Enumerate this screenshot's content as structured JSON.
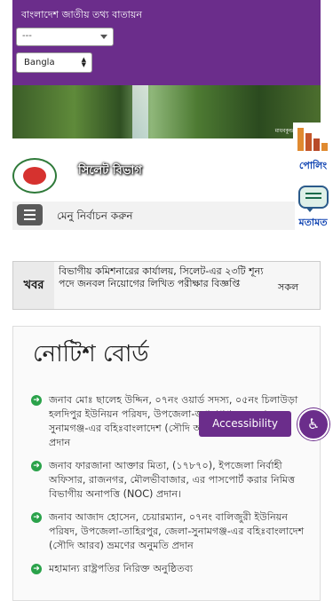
{
  "header": {
    "portal_title": "বাংলাদেশ জাতীয় তথ্য বাতায়ন",
    "site_select_value": "---",
    "language_select_value": "Bangla",
    "banner_credit": "মাধবকুন্ড জলপ্রপাত"
  },
  "branding": {
    "site_name": "সিলেট বিভাগ"
  },
  "menu": {
    "label": "মেনু নির্বাচন করুন"
  },
  "side_widgets": {
    "poll_label": "পোলিং",
    "opinion_label": "মতামত"
  },
  "news": {
    "label": "খবর",
    "headline": "বিভাগীয় কমিশনারের কার্যালয়, সিলেট-এর ২৩টি শূন্য পদে জনবল নিয়োগের লিখিত পরীক্ষার বিজ্ঞপ্তি",
    "all_link": "সকল"
  },
  "notice_board": {
    "title": "নোটিশ বোর্ড",
    "items": [
      "জনাব মোঃ ছালেহ উদ্দিন, ০৭নং ওয়ার্ড সদস্য, ০৫নং চিলাউড়া হলদিপুর ইউনিয়ন পরিষদ, উপজেলা-জগন্নাথপুর, জেলা-সুনামগঞ্জ-এর বহিঃবাংলাদেশ (সৌদি আরব) ভ্রমণের অনুমতি প্রদান",
      "জনাব ফারজানা আক্তার মিতা, (১৭৮৭০), ইপজেলা নির্বাহী অফিসার, রাজনগর, মৌলভীবাজার, এর পাসপোর্ট করার নিমিত্ত বিভাগীয় অনাপত্তি (NOC) প্রদান।",
      "জনাব আজাদ হোসেন, চেয়ারম্যান, ০৭নং বালিজুরী ইউনিয়ন পরিষদ, উপজেলা-তাহিরপুর, জেলা-সুনামগঞ্জ-এর বহিঃবাংলাদেশ (সৌদি আরব) ভ্রমণের অনুমতি প্রদান",
      "মহামান্য রাষ্ট্রপতির নিরিক্ত অনুষ্ঠিতব্য"
    ]
  },
  "accessibility": {
    "button_label": "Accessibility"
  },
  "colors": {
    "header_purple": "#6b2d8b",
    "link_blue": "#0a3fb0",
    "bullet_green": "#2aa24a"
  }
}
